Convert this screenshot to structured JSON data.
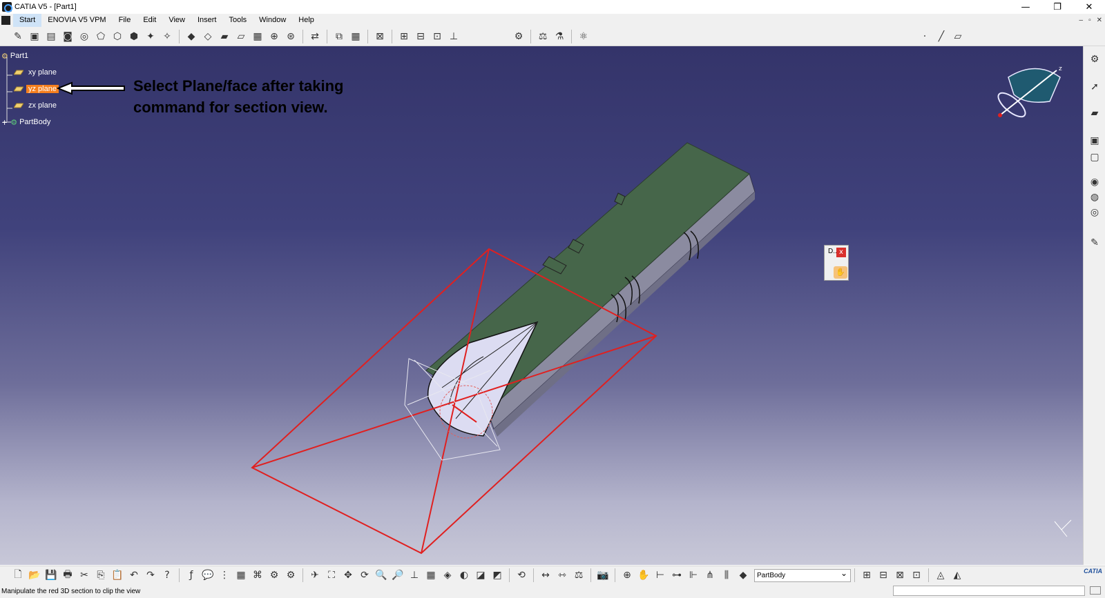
{
  "window": {
    "title": "CATIA V5 - [Part1]",
    "minimize": "—",
    "restore": "❐",
    "close": "✕"
  },
  "menu": {
    "items": [
      {
        "label": "Start"
      },
      {
        "label": "ENOVIA V5 VPM"
      },
      {
        "label": "File"
      },
      {
        "label": "Edit"
      },
      {
        "label": "View"
      },
      {
        "label": "Insert"
      },
      {
        "label": "Tools"
      },
      {
        "label": "Window"
      },
      {
        "label": "Help"
      }
    ],
    "mdi_min": "–",
    "mdi_restore": "▫",
    "mdi_close": "✕"
  },
  "tree": {
    "root": "Part1",
    "items": [
      {
        "label": "xy plane",
        "selected": false
      },
      {
        "label": "yz plane",
        "selected": true
      },
      {
        "label": "zx plane",
        "selected": false
      }
    ],
    "body": "PartBody"
  },
  "annotation": {
    "line1": "Select Plane/face after taking",
    "line2": "command for section view."
  },
  "dialog": {
    "title": "D...",
    "close": "x"
  },
  "compass": {
    "axis_label": "z"
  },
  "toolbar_bottom": {
    "current_body": "PartBody",
    "logo": "CATIA"
  },
  "status": {
    "message": "Manipulate the red 3D section to clip the view"
  },
  "colors": {
    "accent_selection": "#f57f1e",
    "section_plane": "#e02020",
    "part_face": "#46664a",
    "part_side": "#8a8a9e"
  }
}
